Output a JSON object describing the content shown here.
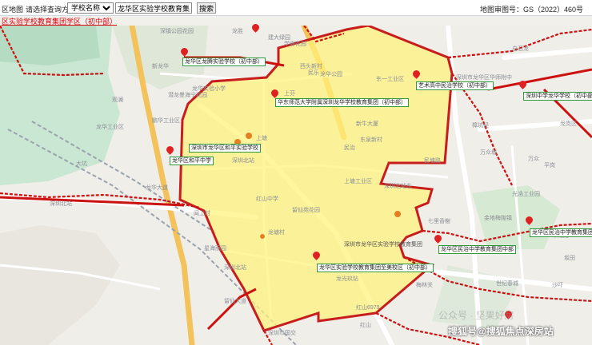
{
  "toolbar": {
    "menu_label": "区地图",
    "mode_label": "请选择查询方式:",
    "mode_value": "学校名称",
    "search_value": "龙华区实验学校教育集团",
    "search_button": "搜索",
    "review_number": "地图审图号：GS（2022）460号"
  },
  "notice": "区实验学校教育集团学区（初中部）",
  "pois": [
    {
      "label": "龙华区龙腾实验学校（初中部）"
    },
    {
      "label": "华东师范大学附属深圳龙华学校教育集团（初中部）"
    },
    {
      "label": "艺术高中民治学校（初中部）"
    },
    {
      "label": "深圳中学龙华学校（初中部）"
    },
    {
      "label": "深圳市龙华区和平实验学校"
    },
    {
      "label": "龙华区和平中学"
    },
    {
      "label": "龙华区民治中学教育集团中部"
    },
    {
      "label": "龙华区民治中学教育集团初中部"
    },
    {
      "label": "龙华区实验学校教育集团至美校区（初中部）"
    },
    {
      "label": "深圳市龙华区实验学校教育集团"
    }
  ],
  "map_labels": {
    "a": "深镇公园花园",
    "b": "龙胜",
    "c": "建大绿园",
    "d": "学府花园",
    "e": "西头新村",
    "f": "龙华公园",
    "g": "东一工业区",
    "h": "新龙华",
    "i": "潜龙曼海宁花园",
    "j": "观澜",
    "k": "龙华实验小学",
    "l": "龙华工业区",
    "m": "鹏华工业区",
    "n": "上塘",
    "o": "上芬",
    "p": "深圳北站",
    "q": "民治",
    "r": "新牛大厦",
    "s": "红山中学",
    "t": "大坑",
    "u": "深圳北站",
    "v": "闻上村",
    "w": "龙塘村",
    "x": "留仙苑花园",
    "y": "星海丽园",
    "z": "深圳北站",
    "aa": "万众",
    "ab": "万众城",
    "ac": "白石龙",
    "ad": "龙岗区",
    "ae": "深圳市龙华区华师附中",
    "af": "上塘工业区",
    "ag": "东泉新村",
    "ah": "樟坑径",
    "ai": "光浩工业园",
    "aj": "七里香榭",
    "ak": "深圳北站东",
    "al": "龙光玖钻",
    "am": "红山6979",
    "an": "深圳市国交",
    "ao": "金地梅陇镇",
    "ap": "布龙路",
    "aq": "民乐",
    "ar": "龙华大道",
    "as": "梅林关",
    "at": "留仙大道",
    "au": "民塘路",
    "av": "沙吓",
    "aw": "世纪春城",
    "ax": "平岗",
    "ay": "坂田",
    "az": "红山"
  },
  "watermark": {
    "wm1": "公众号 · 坚果好房",
    "wm2": "搜狐号@搜狐焦点深房站"
  }
}
